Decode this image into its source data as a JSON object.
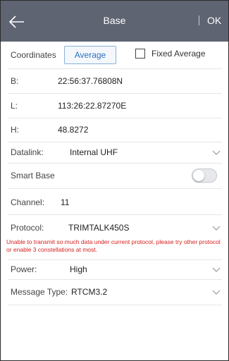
{
  "header": {
    "title": "Base",
    "ok_label": "OK"
  },
  "coordinates": {
    "label": "Coordinates",
    "average_button": "Average",
    "fixed_average_label": "Fixed Average",
    "fixed_average_checked": false
  },
  "fields": {
    "b": {
      "label": "B:",
      "value": "22:56:37.76808N"
    },
    "l": {
      "label": "L:",
      "value": "113:26:22.87270E"
    },
    "h": {
      "label": "H:",
      "value": "48.8272"
    }
  },
  "datalink": {
    "label": "Datalink:",
    "value": "Internal UHF"
  },
  "smart_base": {
    "label": "Smart Base",
    "enabled": false
  },
  "channel": {
    "label": "Channel:",
    "value": "11"
  },
  "protocol": {
    "label": "Protocol:",
    "value": "TRIMTALK450S"
  },
  "warning": "Unable to transmit so much data under current protocol, please try other protocol or enable 3 constellations at most.",
  "power": {
    "label": "Power:",
    "value": "High"
  },
  "message_type": {
    "label": "Message Type:",
    "value": "RTCM3.2"
  },
  "colors": {
    "header_bg": "#5e6472",
    "accent": "#2b6fc2",
    "warning": "#d62020"
  }
}
